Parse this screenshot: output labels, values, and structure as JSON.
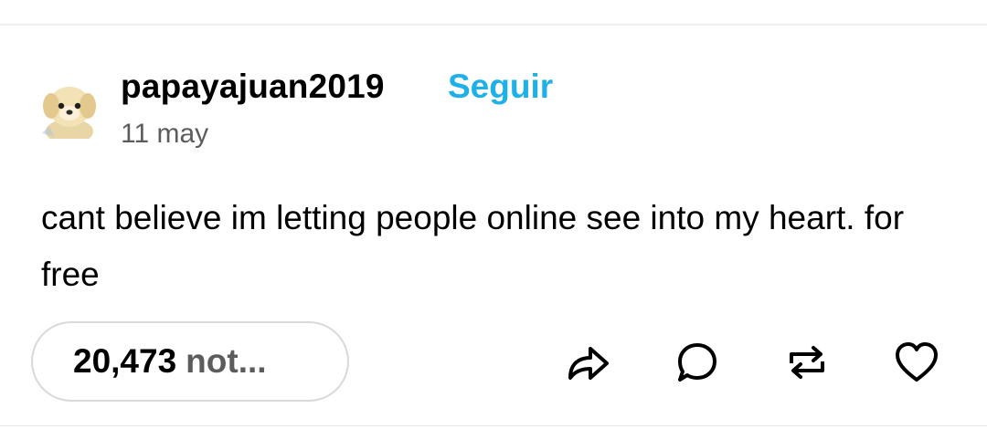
{
  "post": {
    "username": "papayajuan2019",
    "follow_label": "Seguir",
    "date": "11 may",
    "text": "cant believe im letting people online see into my heart. for free",
    "notes": {
      "count": "20,473",
      "suffix": "not..."
    },
    "actions": [
      {
        "name": "share",
        "icon": "share-arrow-icon"
      },
      {
        "name": "reply",
        "icon": "speech-bubble-icon"
      },
      {
        "name": "reblog",
        "icon": "reblog-icon"
      },
      {
        "name": "like",
        "icon": "heart-icon"
      }
    ]
  },
  "colors": {
    "accent": "#1eb0e8",
    "muted_text": "#5c5c5c",
    "pill_border": "#d9d9d9"
  }
}
